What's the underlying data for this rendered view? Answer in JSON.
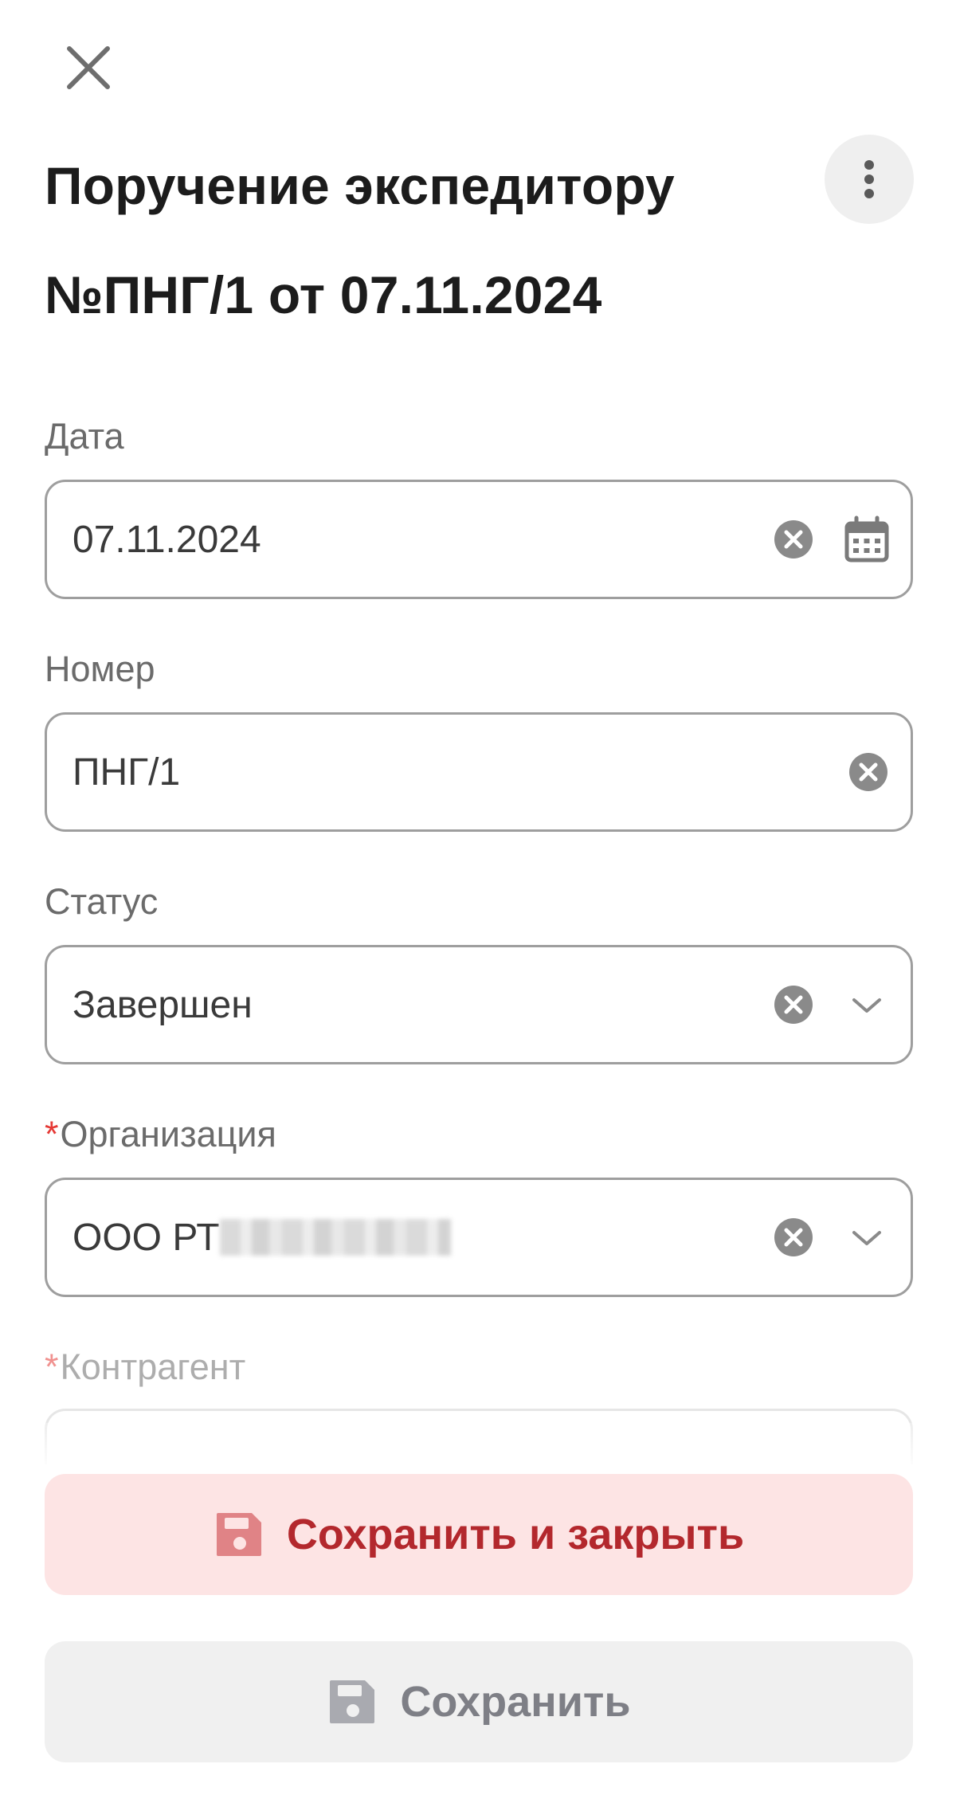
{
  "header": {
    "title": "Поручение экспедитору №ПНГ/1 от 07.11.2024"
  },
  "fields": {
    "date": {
      "label": "Дата",
      "value": "07.11.2024"
    },
    "number": {
      "label": "Номер",
      "value": "ПНГ/1"
    },
    "status": {
      "label": "Статус",
      "value": "Завершен"
    },
    "organization": {
      "label": "Организация",
      "required_mark": "*",
      "value": "ООО РТ"
    },
    "counterparty": {
      "label": "Контрагент",
      "required_mark": "*"
    }
  },
  "actions": {
    "save_close_label": "Сохранить и закрыть",
    "save_label": "Сохранить"
  },
  "colors": {
    "accent": "#b3282d",
    "primary_button_bg": "#fde4e4",
    "required": "#e53935"
  }
}
